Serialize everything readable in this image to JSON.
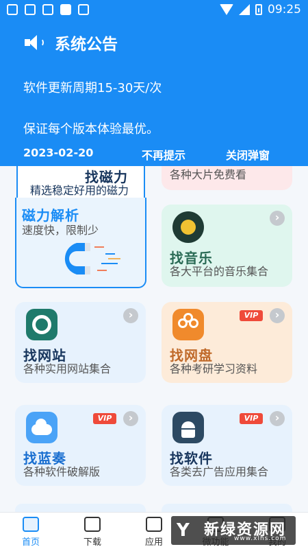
{
  "status_bar": {
    "time": "09:25"
  },
  "notice": {
    "title": "系统公告",
    "line1": "软件更新周期15-30天/次",
    "line2": "保证每个版本体验最优。",
    "date": "2023-02-20",
    "no_show_label": "不再提示",
    "close_label": "关闭弹窗"
  },
  "cards": {
    "magnet_top": {
      "title": "找磁力",
      "subtitle": "精选稳定好用的磁力"
    },
    "movies": {
      "subtitle": "各种大片免费看"
    },
    "magnet_parse": {
      "title": "磁力解析",
      "subtitle": "速度快，限制少"
    },
    "music": {
      "title": "找音乐",
      "subtitle": "各大平台的音乐集合"
    },
    "websites": {
      "title": "找网站",
      "subtitle": "各种实用网站集合"
    },
    "netdisk": {
      "title": "找网盘",
      "subtitle": "各种考研学习资料",
      "badge": "VIP"
    },
    "lanzou": {
      "title": "找蓝奏",
      "subtitle": "各种软件破解版",
      "badge": "VIP"
    },
    "software": {
      "title": "找软件",
      "subtitle": "各类去广告应用集合",
      "badge": "VIP"
    }
  },
  "nav": {
    "home": "首页",
    "download": "下载",
    "apps": "应用",
    "micro": "微功能",
    "mine": "我的"
  },
  "watermark": {
    "cn": "新绿资源网",
    "en": "www.xlhs.com"
  },
  "colors": {
    "accent": "#1a8cf5",
    "vip": "#ef4a3a"
  }
}
